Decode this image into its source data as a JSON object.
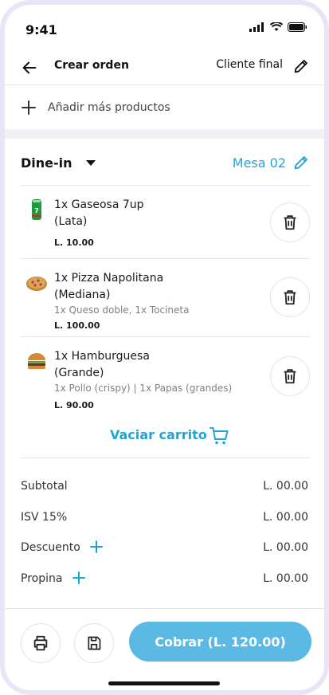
{
  "status": {
    "time": "9:41"
  },
  "header": {
    "title": "Crear orden",
    "client": "Cliente final"
  },
  "add": {
    "label": "Añadir más productos"
  },
  "service": {
    "mode": "Dine-in",
    "table": "Mesa 02"
  },
  "items": [
    {
      "name": "1x Gaseosa 7up\n(Lata)",
      "name_lines": [
        "1x Gaseosa 7up",
        "(Lata)"
      ],
      "mods": "",
      "price": "L. 10.00",
      "icon": "soda-can-icon"
    },
    {
      "name": "1x Pizza Napolitana\n(Mediana)",
      "name_lines": [
        "1x Pizza Napolitana",
        "(Mediana)"
      ],
      "mods": "1x Queso doble, 1x Tocineta",
      "price": "L. 100.00",
      "icon": "pizza-icon"
    },
    {
      "name": "1x Hamburguesa\n(Grande)",
      "name_lines": [
        "1x Hamburguesa",
        "(Grande)"
      ],
      "mods": "1x Pollo (crispy) | 1x Papas (grandes)",
      "price": "L. 90.00",
      "icon": "burger-icon"
    }
  ],
  "empty_cart": {
    "label": "Vaciar carrito"
  },
  "totals": [
    {
      "label": "Subtotal",
      "value": "L. 00.00",
      "addable": false
    },
    {
      "label": "ISV 15%",
      "value": "L. 00.00",
      "addable": false
    },
    {
      "label": "Descuento",
      "value": "L. 00.00",
      "addable": true
    },
    {
      "label": "Propina",
      "value": "L. 00.00",
      "addable": true
    }
  ],
  "footer": {
    "pay_label": "Cobrar  (L. 120.00)"
  },
  "colors": {
    "accent": "#1ba6d6",
    "pay_button": "#5bb9e3",
    "frame": "#e6e6f6"
  }
}
